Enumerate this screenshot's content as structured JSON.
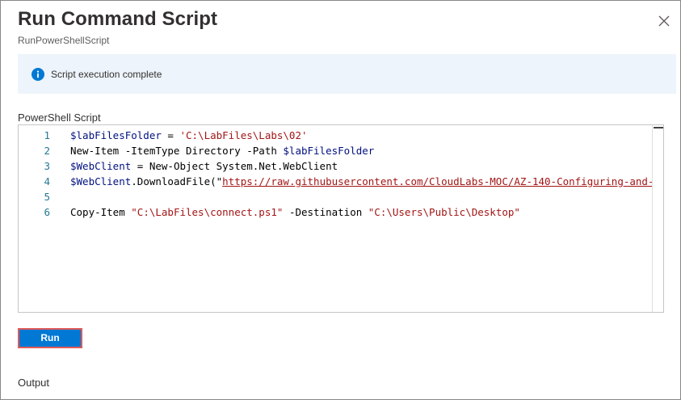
{
  "panel": {
    "title": "Run Command Script",
    "subtitle": "RunPowerShellScript",
    "close_icon": "close-icon"
  },
  "banner": {
    "icon": "info-icon",
    "message": "Script execution complete",
    "background": "#eef4fb",
    "accent": "#0078d4"
  },
  "editor": {
    "label": "PowerShell Script",
    "lines": [
      {
        "num": "1",
        "parts": [
          {
            "t": "$labFilesFolder",
            "c": "var"
          },
          {
            "t": " = ",
            "c": ""
          },
          {
            "t": "'C:\\LabFiles\\Labs\\02'",
            "c": "str"
          }
        ]
      },
      {
        "num": "2",
        "parts": [
          {
            "t": "New-Item -ItemType Directory -Path ",
            "c": ""
          },
          {
            "t": "$labFilesFolder",
            "c": "var"
          }
        ]
      },
      {
        "num": "3",
        "parts": [
          {
            "t": "$WebClient",
            "c": "var"
          },
          {
            "t": " = New-Object System.Net.WebClient",
            "c": ""
          }
        ]
      },
      {
        "num": "4",
        "parts": [
          {
            "t": "$WebClient",
            "c": "var"
          },
          {
            "t": ".DownloadFile(\"",
            "c": ""
          },
          {
            "t": "https://raw.githubusercontent.com/CloudLabs-MOC/AZ-140-Configuring-and-",
            "c": "link"
          }
        ]
      },
      {
        "num": "5",
        "parts": []
      },
      {
        "num": "6",
        "parts": [
          {
            "t": "Copy-Item ",
            "c": ""
          },
          {
            "t": "\"C:\\LabFiles\\connect.ps1\"",
            "c": "str"
          },
          {
            "t": " -Destination ",
            "c": ""
          },
          {
            "t": "\"C:\\Users\\Public\\Desktop\"",
            "c": "str"
          }
        ]
      }
    ]
  },
  "actions": {
    "run_label": "Run",
    "run_color": "#0078d4",
    "highlight_color": "#e05a5a"
  },
  "output": {
    "label": "Output"
  }
}
